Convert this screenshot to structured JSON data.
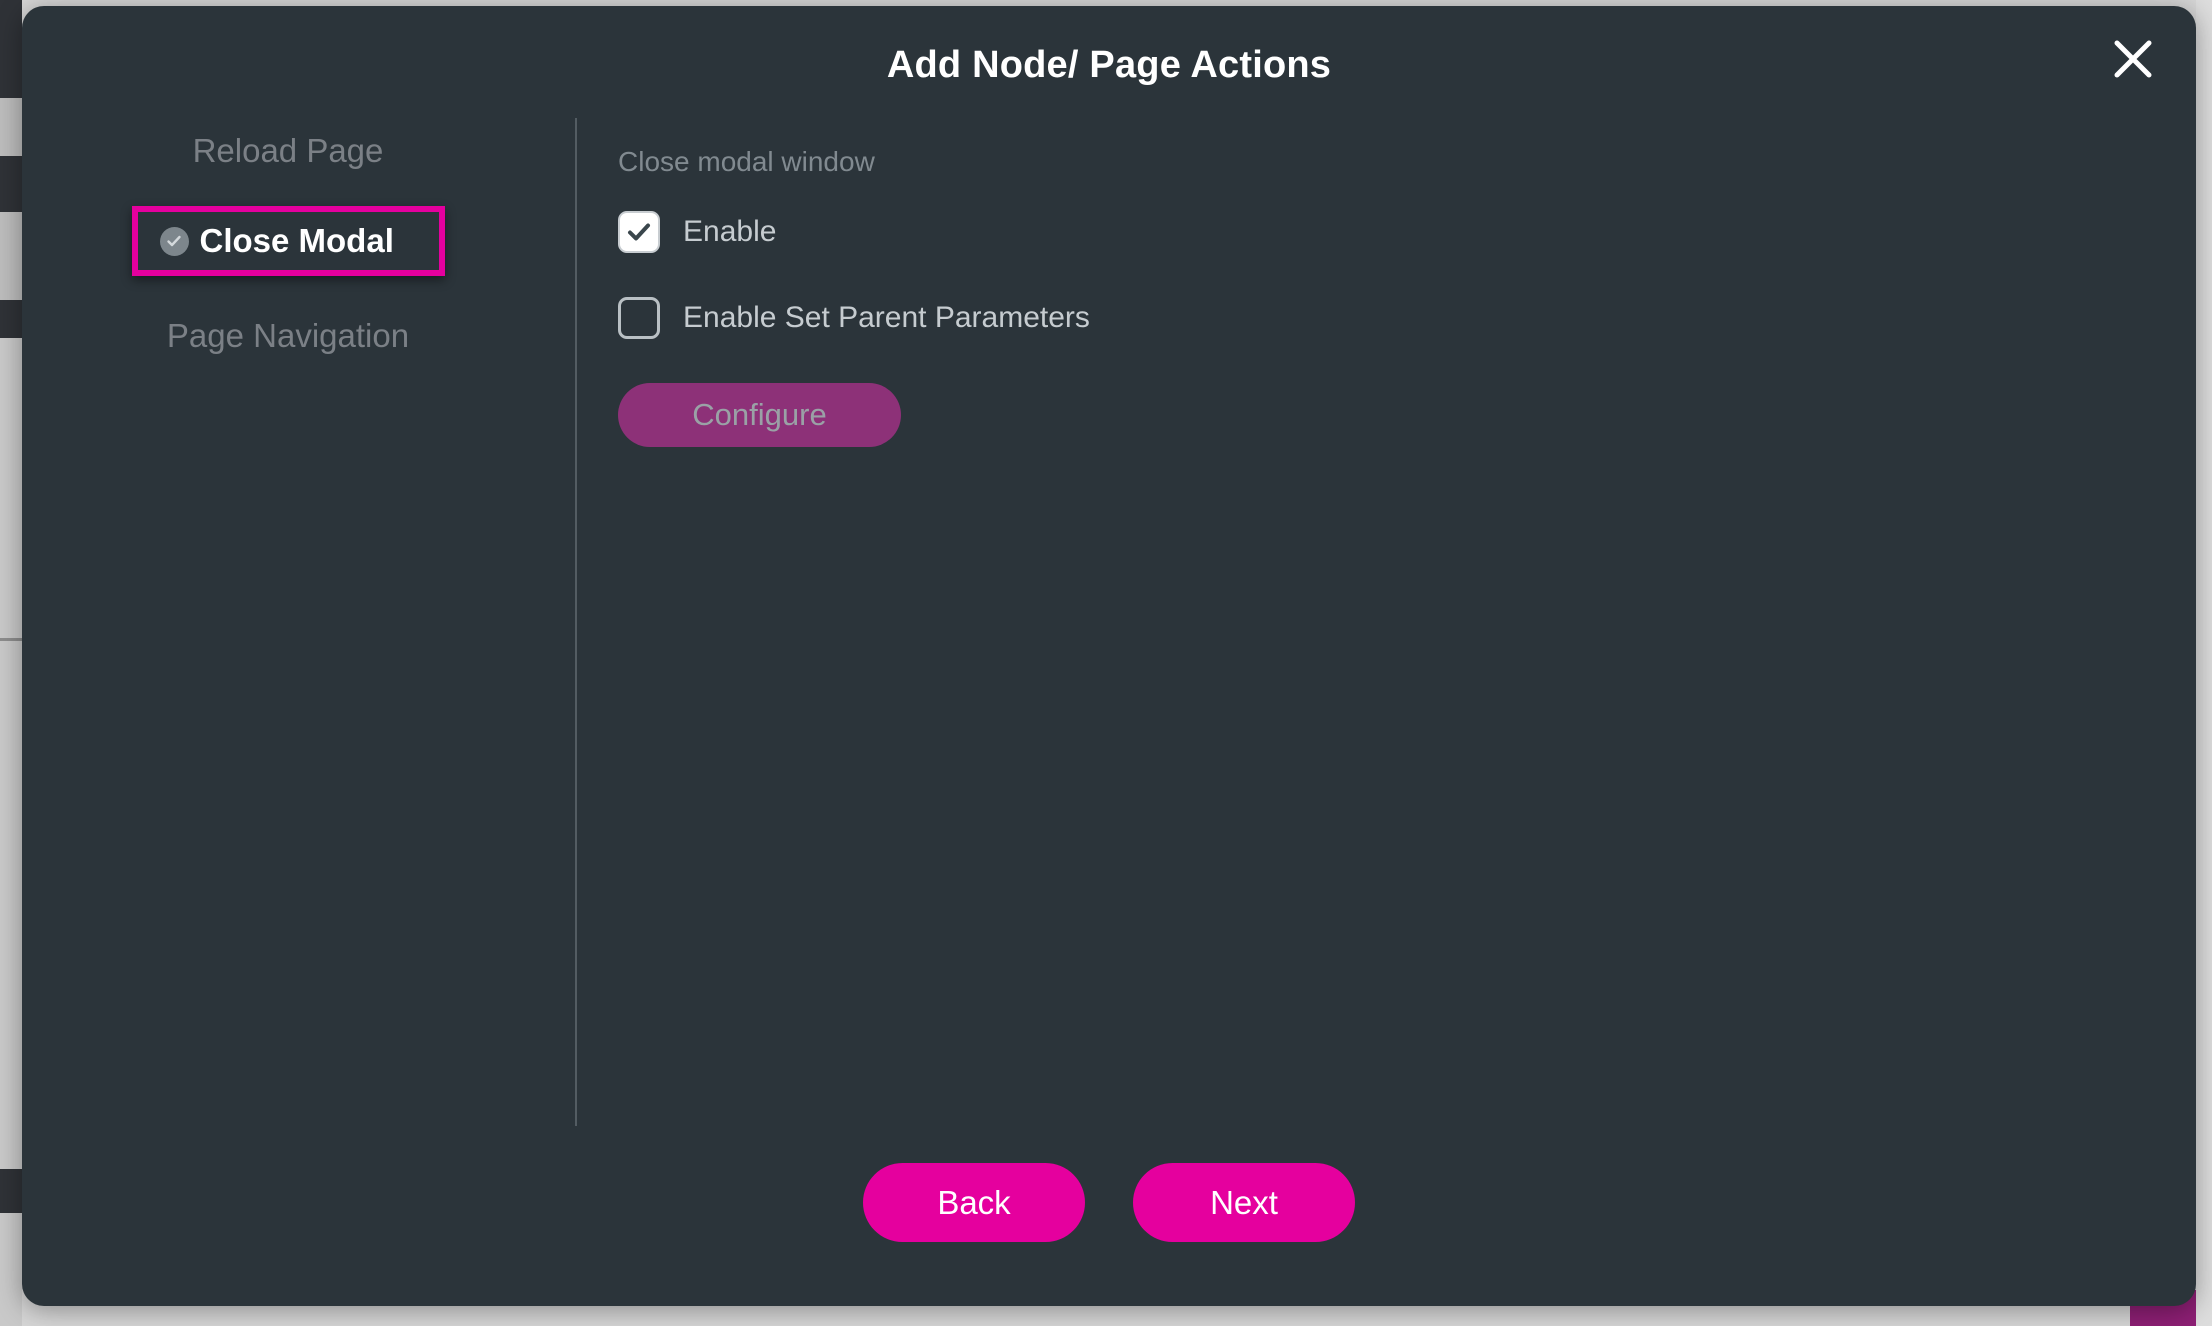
{
  "modal": {
    "title": "Add Node/ Page Actions",
    "close_icon": "close-icon",
    "nav": {
      "items": [
        {
          "label": "Reload Page",
          "selected": false
        },
        {
          "label": "Close Modal",
          "selected": true,
          "icon": "circle-check-icon"
        },
        {
          "label": "Page Navigation",
          "selected": false
        }
      ]
    },
    "content": {
      "section_label": "Close modal window",
      "options": [
        {
          "label": "Enable",
          "checked": true
        },
        {
          "label": "Enable Set Parent Parameters",
          "checked": false
        }
      ],
      "configure_label": "Configure"
    },
    "footer": {
      "back_label": "Back",
      "next_label": "Next"
    }
  },
  "colors": {
    "modal_bg": "#2b343a",
    "accent_magenta": "#e5009e",
    "configure_purple": "#8d3178",
    "muted_text": "#7b8086",
    "body_text": "#c6ccd0",
    "title_text": "#ffffff"
  }
}
